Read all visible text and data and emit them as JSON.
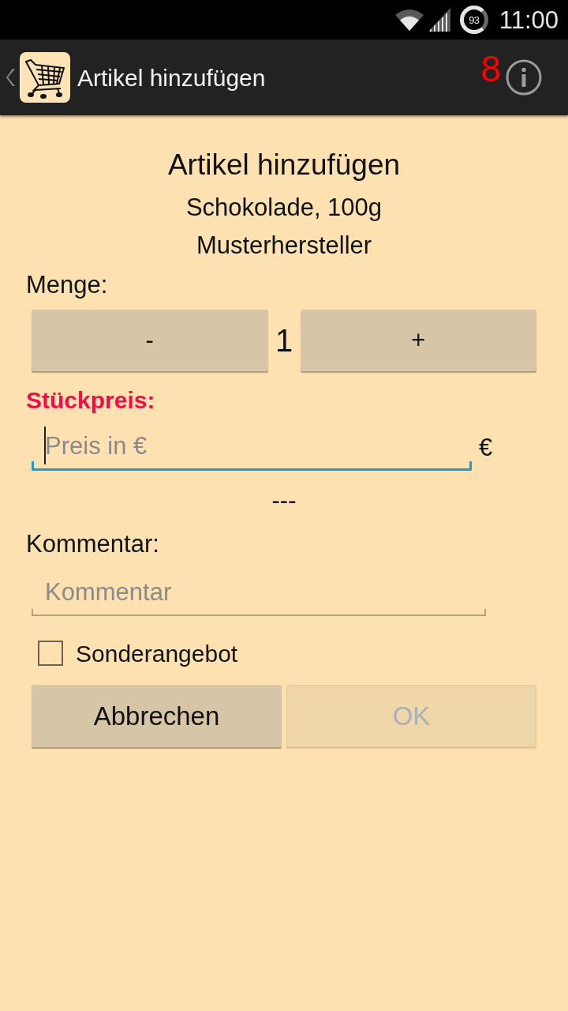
{
  "status_bar": {
    "battery": "93",
    "time": "11:00"
  },
  "action_bar": {
    "title": "Artikel hinzufügen",
    "count": "8"
  },
  "header": {
    "title": "Artikel hinzufügen",
    "product": "Schokolade, 100g",
    "manufacturer": "Musterhersteller"
  },
  "quantity": {
    "label": "Menge:",
    "decrease": "-",
    "value": "1",
    "increase": "+"
  },
  "price": {
    "label": "Stückpreis:",
    "invalid": true,
    "placeholder": "Preis in €",
    "focused": true,
    "currency": "€",
    "total": "---"
  },
  "comment": {
    "label": "Kommentar:",
    "placeholder": "Kommentar",
    "focused": false
  },
  "special_offer": {
    "label": "Sonderangebot",
    "checked": false
  },
  "buttons": [
    {
      "label": "Abbrechen",
      "disabled": false
    },
    {
      "label": "OK",
      "disabled": true
    }
  ]
}
